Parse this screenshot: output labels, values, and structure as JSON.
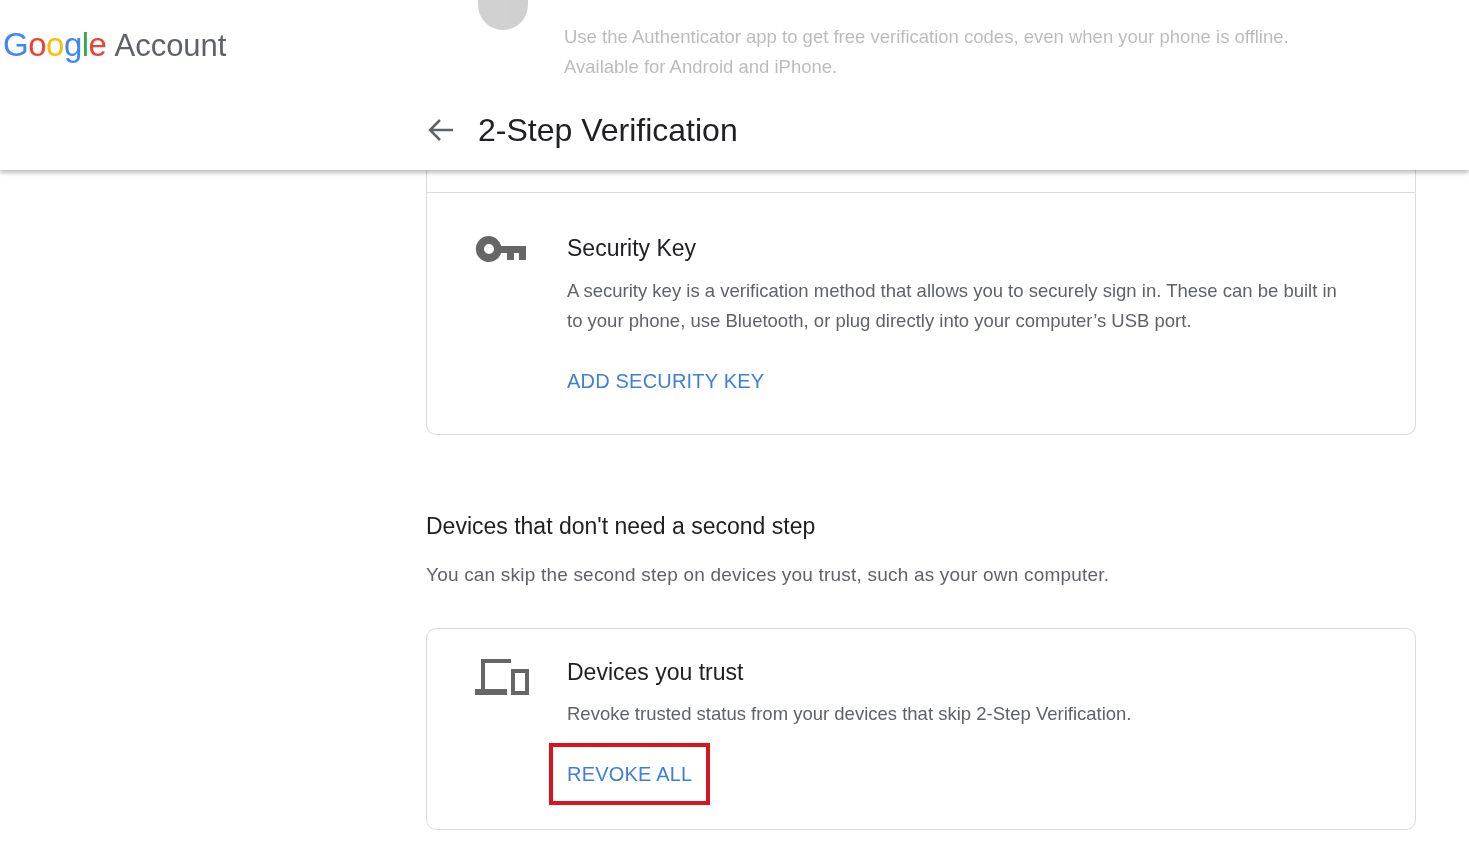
{
  "brand": {
    "logo": "Google",
    "product": "Account"
  },
  "behind_header": {
    "description": "Use the Authenticator app to get free verification codes, even when your phone is offline.\nAvailable for Android and iPhone."
  },
  "header": {
    "title": "2-Step Verification"
  },
  "cards": [
    {
      "kind": "key",
      "title": "Security Key",
      "description": "A security key is a verification method that allows you to securely sign in. These can be built in to your phone, use Bluetooth, or plug directly into your computer’s USB port.",
      "action": {
        "label": "ADD SECURITY KEY",
        "highlighted": false
      }
    },
    {
      "kind": "devices",
      "section_title": "Devices that don't need a second step",
      "section_description": "You can skip the second step on devices you trust, such as your own computer.",
      "title": "Devices you trust",
      "description": "Revoke trusted status from your devices that skip 2-Step Verification.",
      "action": {
        "label": "REVOKE ALL",
        "highlighted": true
      }
    }
  ]
}
